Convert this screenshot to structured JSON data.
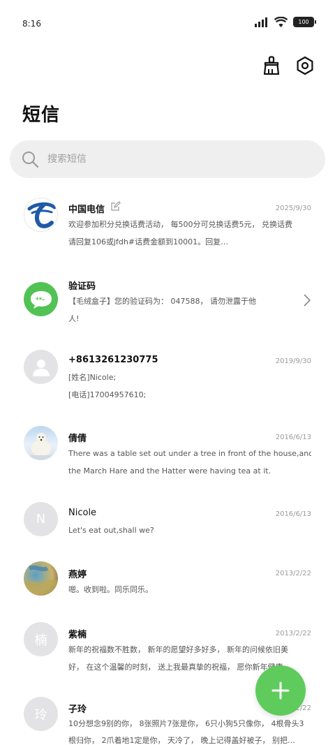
{
  "status": {
    "time": "8:16",
    "battery": "100"
  },
  "header": {
    "title": "短信"
  },
  "search": {
    "placeholder": "搜索短信"
  },
  "messages": [
    {
      "name": "中国电信",
      "date": "2025/9/30",
      "line1": "欢迎参加积分兑换话费活动， 每500分可兑换话费5元， 兑换话费",
      "line2": "请回复106或jfdh#话费金额到10001。回复…"
    },
    {
      "name": "验证码",
      "date": "",
      "line1": "【毛绒盒子】您的验证码为： 047588， 请勿泄露于他",
      "line2": "人!"
    },
    {
      "name": "+8613261230775",
      "date": "2019/9/30",
      "line1": "[姓名]Nicole;",
      "line2": "[电话]17004957610;"
    },
    {
      "name": "倩倩",
      "date": "2016/6/13",
      "line1": "There was a table set out under a tree in front of the house,and",
      "line2": "the March Hare and the Hatter were having tea at it."
    },
    {
      "name": "Nicole",
      "date": "2016/6/13",
      "line1": "Let's eat out,shall we?",
      "avatar_letter": "N"
    },
    {
      "name": "燕婷",
      "date": "2013/2/22",
      "line1": "嗯。收到啦。同乐同乐。"
    },
    {
      "name": "紫楠",
      "date": "2013/2/22",
      "line1": "新年的祝福数不胜数， 新年的愿望好多好多， 新年的问候依旧美",
      "line2": "好， 在这个温馨的时刻， 送上我最真挚的祝福， 愿你新年健康…",
      "avatar_letter": "楠"
    },
    {
      "name": "子玲",
      "date": "2013/2/22",
      "line1": "10分想念9别的你， 8张照片7张是你， 6只小狗5只像你， 4根骨头3",
      "line2": "根归你， 2爪着地1定是你， 天冷了， 晚上记得盖好被子， 别把…",
      "avatar_letter": "玲"
    }
  ],
  "colors": {
    "accent": "#5fcb5c",
    "telecom_blue": "#1f5aa8"
  }
}
